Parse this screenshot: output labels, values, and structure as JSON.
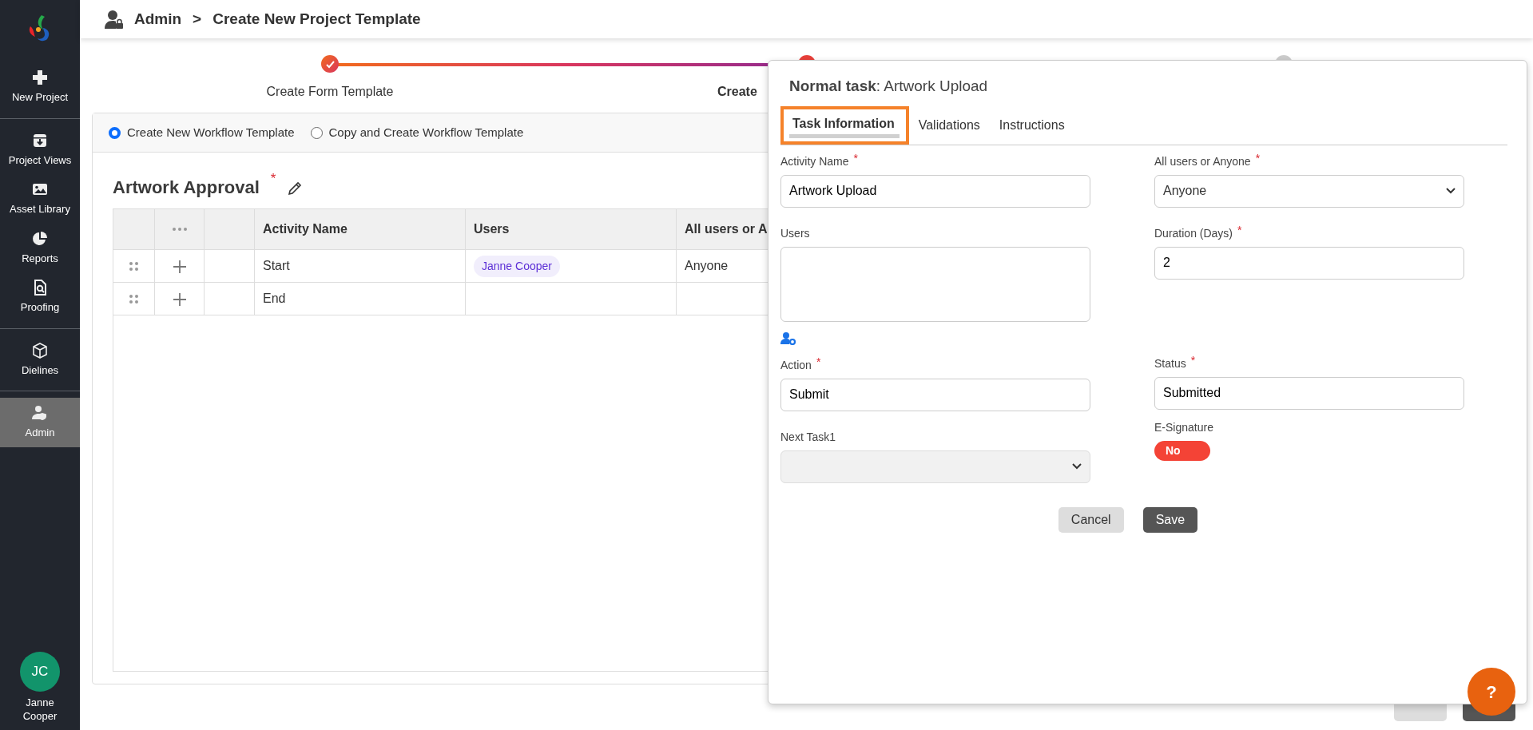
{
  "sidebar": {
    "groups": [
      [
        {
          "label": "New Project",
          "kind": "plus",
          "selected": false
        }
      ],
      [
        {
          "label": "Project Views",
          "kind": "archive",
          "selected": false
        },
        {
          "label": "Asset Library",
          "kind": "image",
          "selected": false
        },
        {
          "label": "Reports",
          "kind": "pie",
          "selected": false
        },
        {
          "label": "Proofing",
          "kind": "doc-search",
          "selected": false
        }
      ],
      [
        {
          "label": "Dielines",
          "kind": "box",
          "selected": false
        }
      ],
      [
        {
          "label": "Admin",
          "kind": "user-shield",
          "selected": true
        }
      ]
    ],
    "user": {
      "initials": "JC",
      "name": "Janne Cooper"
    }
  },
  "breadcrumb": {
    "items": [
      "Admin",
      "Create New Project Template"
    ],
    "separator": ">"
  },
  "stepper": {
    "steps": [
      {
        "label": "Create Form Template",
        "kind": "done"
      },
      {
        "label": "Create",
        "kind": "current"
      },
      {
        "kind": "pending"
      }
    ]
  },
  "template_options": [
    {
      "label": "Create New Workflow Template",
      "selected": true
    },
    {
      "label": "Copy and Create Workflow Template",
      "selected": false
    }
  ],
  "required_mark": "*",
  "workflow": {
    "title": "Artwork Approval",
    "required": true
  },
  "table": {
    "columns": [
      "Activity Name",
      "Users",
      "All users or A"
    ],
    "rows": [
      {
        "activity": "Start",
        "users": [
          "Janne Cooper"
        ],
        "assignment": "Anyone"
      },
      {
        "activity": "End",
        "users": []
      }
    ]
  },
  "footer_buttons": [
    {
      "kind": "secondary"
    },
    {
      "kind": "dark"
    }
  ],
  "panel": {
    "title": "**Normal task**: Artwork Upload",
    "tabs": [
      {
        "label": "Task Information",
        "selected": true
      },
      {
        "label": "Validations",
        "selected": false
      },
      {
        "label": "Instructions",
        "selected": false
      }
    ],
    "left": [
      {
        "kind": "text",
        "label": "Activity Name",
        "required": true,
        "value": "Artwork Upload"
      },
      {
        "kind": "users",
        "label": "Users",
        "required": false
      },
      {
        "kind": "text",
        "label": "Action",
        "required": true,
        "value": "Submit"
      },
      {
        "kind": "select",
        "label": "Next Task1",
        "required": false,
        "disabled": true
      }
    ],
    "right": [
      {
        "kind": "select",
        "label": "All users or Anyone",
        "required": true,
        "value": "Anyone"
      },
      {
        "kind": "text",
        "label": "Duration (Days)",
        "required": true,
        "value": "2"
      },
      {
        "kind": "text",
        "label": "Status",
        "required": true,
        "value": "Submitted"
      },
      {
        "kind": "toggle",
        "label": "E-Signature",
        "required": false,
        "on": false,
        "text": "No"
      }
    ],
    "buttons": [
      {
        "label": "Cancel",
        "kind": "secondary"
      },
      {
        "label": "Save",
        "kind": "primary"
      }
    ]
  },
  "help": {
    "label": "?"
  }
}
